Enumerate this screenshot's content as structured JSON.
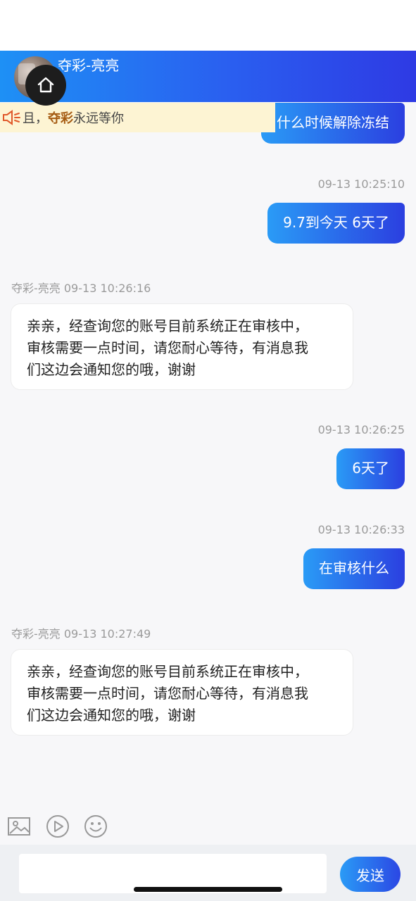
{
  "header": {
    "agent_name": "夺彩-亮亮"
  },
  "notice": {
    "prefix": "且，",
    "brand": "夺彩",
    "suffix": "永远等你"
  },
  "messages": [
    {
      "side": "right",
      "time": "",
      "text": "什么时候解除冻结"
    },
    {
      "side": "right",
      "time": "09-13 10:25:10",
      "text": "9.7到今天 6天了"
    },
    {
      "side": "left",
      "sender": "夺彩-亮亮",
      "time": "09-13 10:26:16",
      "lines": [
        "亲亲，经查询您的账号目前系统正在审核中，",
        "审核需要一点时间，请您耐心等待，有消息我",
        "们这边会通知您的哦，谢谢"
      ]
    },
    {
      "side": "right",
      "time": "09-13 10:26:25",
      "text": "6天了"
    },
    {
      "side": "right",
      "time": "09-13 10:26:33",
      "text": "在审核什么"
    },
    {
      "side": "left",
      "sender": "夺彩-亮亮",
      "time": "09-13 10:27:49",
      "lines": [
        "亲亲，经查询您的账号目前系统正在审核中，",
        "审核需要一点时间，请您耐心等待，有消息我",
        "们这边会通知您的哦，谢谢"
      ]
    }
  ],
  "toolbar": {
    "icons": [
      "image-icon",
      "video-icon",
      "emoji-icon"
    ]
  },
  "input": {
    "value": "",
    "placeholder": ""
  },
  "send": {
    "label": "发送"
  },
  "colors": {
    "brand_gradient_start": "#1e90f5",
    "brand_gradient_end": "#2e3ae4",
    "notice_bg": "#fdf4d3",
    "notice_brand": "#a55a11"
  }
}
